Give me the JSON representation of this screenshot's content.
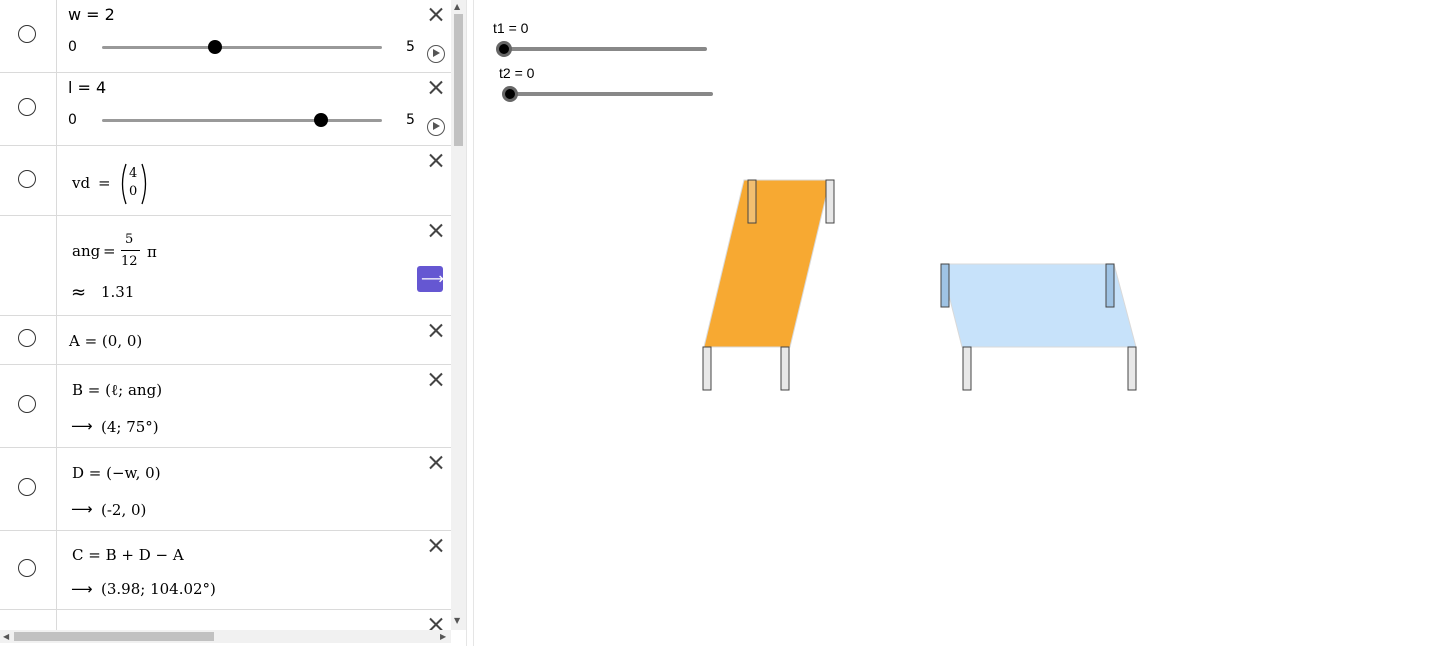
{
  "algebra": {
    "w_slider": {
      "label": "w = 2",
      "min": "0",
      "max": "5",
      "value": 2
    },
    "l_slider": {
      "label": "l = 4",
      "min": "0",
      "max": "5",
      "value": 4
    },
    "vd": {
      "name": "vd",
      "eq": "=",
      "top": "4",
      "bottom": "0"
    },
    "ang": {
      "name": "ang",
      "eq": "=",
      "num": "5",
      "den": "12",
      "pi": "π",
      "approx_sym": "≈",
      "approx_val": "1.31"
    },
    "A": {
      "def": "A = (0, 0)"
    },
    "B": {
      "def": "B = (ℓ; ang)",
      "arrow": "⟶",
      "val": "(4; 75°)"
    },
    "D": {
      "def": "D = (−w, 0)",
      "arrow": "⟶",
      "val": "(-2, 0)"
    },
    "C": {
      "def": "C = B + D − A",
      "arrow": "⟶",
      "val": "(3.98; 104.02°)"
    }
  },
  "graphics": {
    "t1": {
      "label": "t1 = 0",
      "value": 0
    },
    "t2": {
      "label": "t2 = 0",
      "value": 0
    },
    "colors": {
      "orange": "#f7a932",
      "blue": "#c7e2fa",
      "leg_fill": "#e8e8e8",
      "leg_stroke": "#444444"
    }
  }
}
